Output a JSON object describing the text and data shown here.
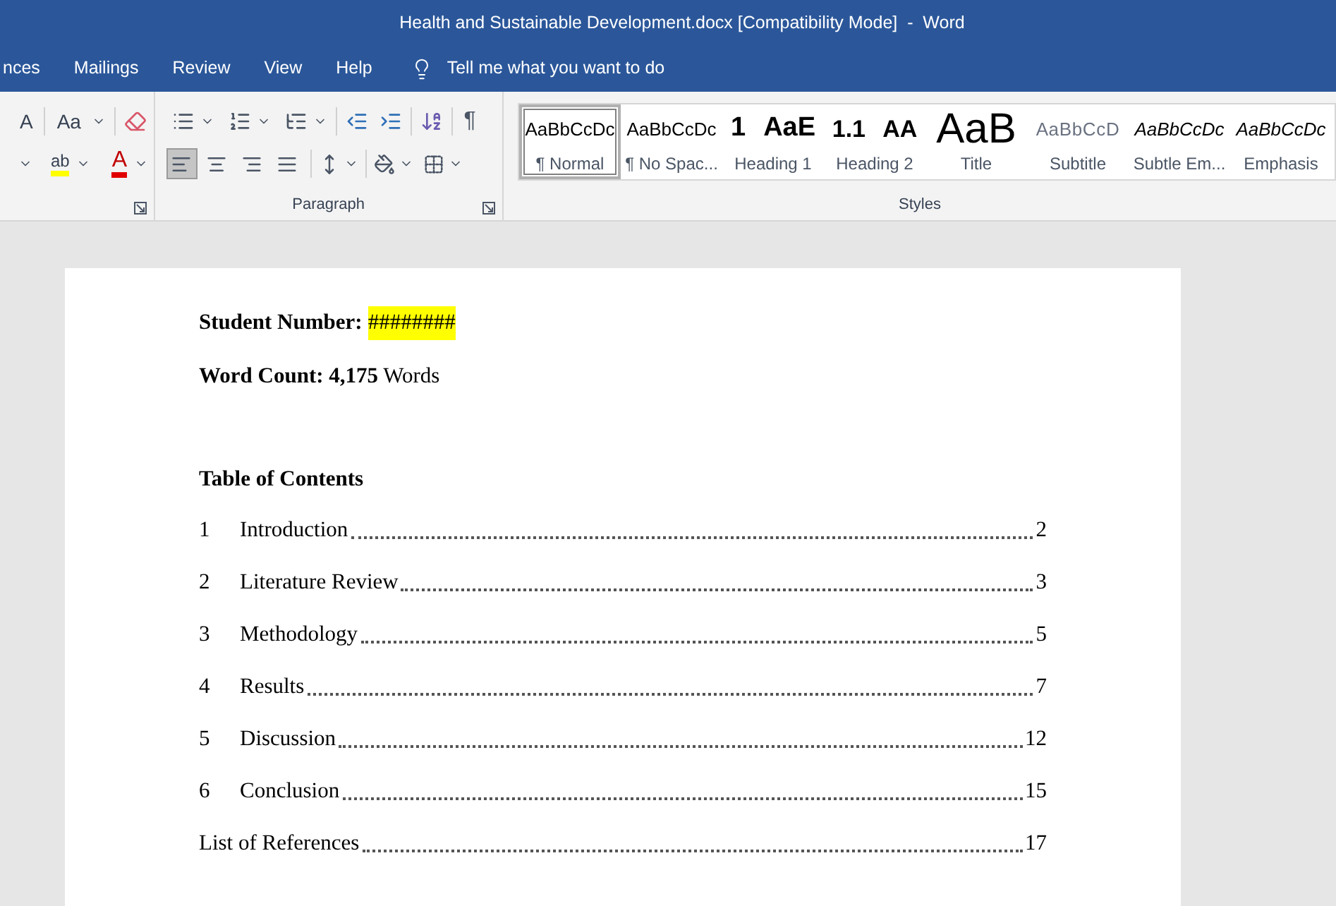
{
  "window": {
    "title": "Health and Sustainable Development.docx [Compatibility Mode]  -  Word"
  },
  "tabs": [
    {
      "label": "nces",
      "selected": false
    },
    {
      "label": "Mailings",
      "selected": false
    },
    {
      "label": "Review",
      "selected": false
    },
    {
      "label": "View",
      "selected": false
    },
    {
      "label": "Help",
      "selected": false
    }
  ],
  "tell_me": {
    "placeholder": "Tell me what you want to do"
  },
  "font_group": {
    "grow_font": "A",
    "change_case": "Aa",
    "highlight": "ab",
    "font_color": "A"
  },
  "paragraph_group": {
    "label": "Paragraph",
    "show_marks": "¶",
    "alignment": [
      {
        "kind": "left",
        "selected": true
      },
      {
        "kind": "center",
        "selected": false
      },
      {
        "kind": "right",
        "selected": false
      },
      {
        "kind": "justify",
        "selected": false
      }
    ]
  },
  "styles_group": {
    "label": "Styles",
    "styles": [
      {
        "kind": "normal",
        "sample": "AaBbCcDc",
        "label": "¶ Normal",
        "selected": true
      },
      {
        "kind": "normal",
        "sample": "AaBbCcDc",
        "label": "¶ No Spac...",
        "selected": false
      },
      {
        "kind": "heading1",
        "sample": "1 AaE",
        "label": "Heading 1",
        "selected": false
      },
      {
        "kind": "heading2",
        "sample": "1.1 AA",
        "label": "Heading 2",
        "selected": false
      },
      {
        "kind": "title",
        "sample": "AaB",
        "label": "Title",
        "selected": false
      },
      {
        "kind": "subtitle",
        "sample": "AaBbCcD",
        "label": "Subtitle",
        "selected": false
      },
      {
        "kind": "emphasis",
        "sample": "AaBbCcDc",
        "label": "Subtle Em...",
        "selected": false
      },
      {
        "kind": "emphasis",
        "sample": "AaBbCcDc",
        "label": "Emphasis",
        "selected": false
      }
    ]
  },
  "document": {
    "student_number": {
      "label": "Student Number:",
      "value": "########"
    },
    "word_count": "**Word Count: 4,175** Words",
    "toc_heading": "Table of Contents",
    "toc": [
      {
        "number": "1",
        "title": "Introduction",
        "page": "2"
      },
      {
        "number": "2",
        "title": "Literature Review",
        "page": "3"
      },
      {
        "number": "3",
        "title": "Methodology",
        "page": "5"
      },
      {
        "number": "4",
        "title": "Results",
        "page": "7"
      },
      {
        "number": "5",
        "title": "Discussion",
        "page": "12"
      },
      {
        "number": "6",
        "title": "Conclusion",
        "page": "15"
      },
      {
        "title": "List of References",
        "page": "17"
      }
    ]
  }
}
